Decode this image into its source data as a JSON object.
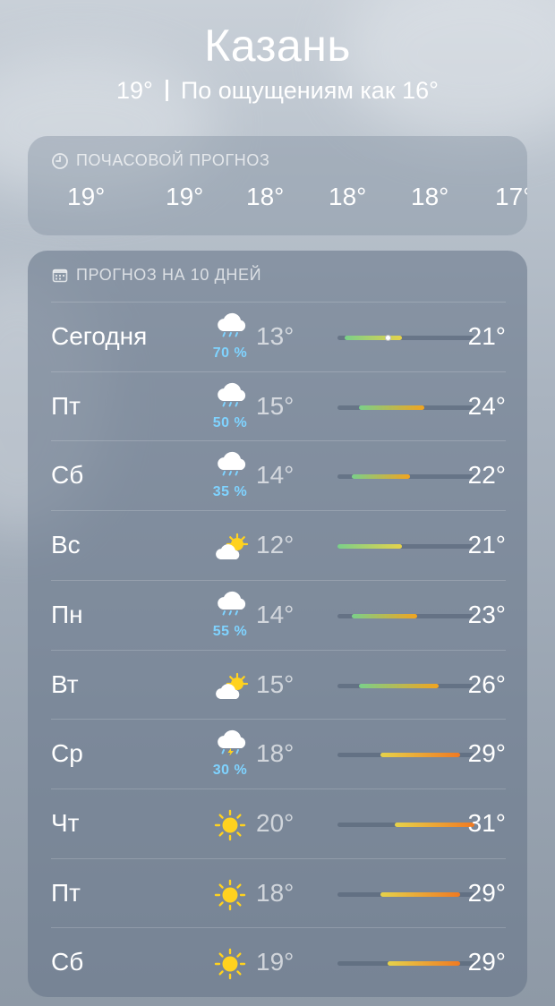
{
  "header": {
    "city": "Казань",
    "current_temp": "19°",
    "feels_like": "По ощущениям как 16°"
  },
  "hourly": {
    "title": "ПОЧАСОВОЙ ПРОГНОЗ",
    "icon": "clock-icon",
    "temps": [
      "19°",
      "19°",
      "18°",
      "18°",
      "18°",
      "17°"
    ]
  },
  "daily": {
    "title": "ПРОГНОЗ НА 10 ДНЕЙ",
    "icon": "calendar-icon",
    "days": [
      {
        "name": "Сегодня",
        "icon": "rain-cloud-icon",
        "precip": "70 %",
        "low": "13°",
        "high": "21°",
        "range": [
          13,
          21
        ],
        "current": 19
      },
      {
        "name": "Пт",
        "icon": "rain-cloud-icon",
        "precip": "50 %",
        "low": "15°",
        "high": "24°",
        "range": [
          15,
          24
        ]
      },
      {
        "name": "Сб",
        "icon": "rain-cloud-icon",
        "precip": "35 %",
        "low": "14°",
        "high": "22°",
        "range": [
          14,
          22
        ]
      },
      {
        "name": "Вс",
        "icon": "partly-sunny-icon",
        "precip": "",
        "low": "12°",
        "high": "21°",
        "range": [
          12,
          21
        ]
      },
      {
        "name": "Пн",
        "icon": "rain-cloud-icon",
        "precip": "55 %",
        "low": "14°",
        "high": "23°",
        "range": [
          14,
          23
        ]
      },
      {
        "name": "Вт",
        "icon": "partly-sunny-icon",
        "precip": "",
        "low": "15°",
        "high": "26°",
        "range": [
          15,
          26
        ]
      },
      {
        "name": "Ср",
        "icon": "thunderstorm-icon",
        "precip": "30 %",
        "low": "18°",
        "high": "29°",
        "range": [
          18,
          29
        ]
      },
      {
        "name": "Чт",
        "icon": "sun-icon",
        "precip": "",
        "low": "20°",
        "high": "31°",
        "range": [
          20,
          31
        ]
      },
      {
        "name": "Пт",
        "icon": "sun-icon",
        "precip": "",
        "low": "18°",
        "high": "29°",
        "range": [
          18,
          29
        ]
      },
      {
        "name": "Сб",
        "icon": "sun-icon",
        "precip": "",
        "low": "19°",
        "high": "29°",
        "range": [
          19,
          29
        ]
      }
    ],
    "scale_min": 12,
    "scale_max": 31
  },
  "colors": {
    "precip": "#7fd3ff",
    "cool": "#7ad08a",
    "mild": "#e6d24a",
    "warm": "#f2a41f",
    "hot": "#f07a22"
  }
}
